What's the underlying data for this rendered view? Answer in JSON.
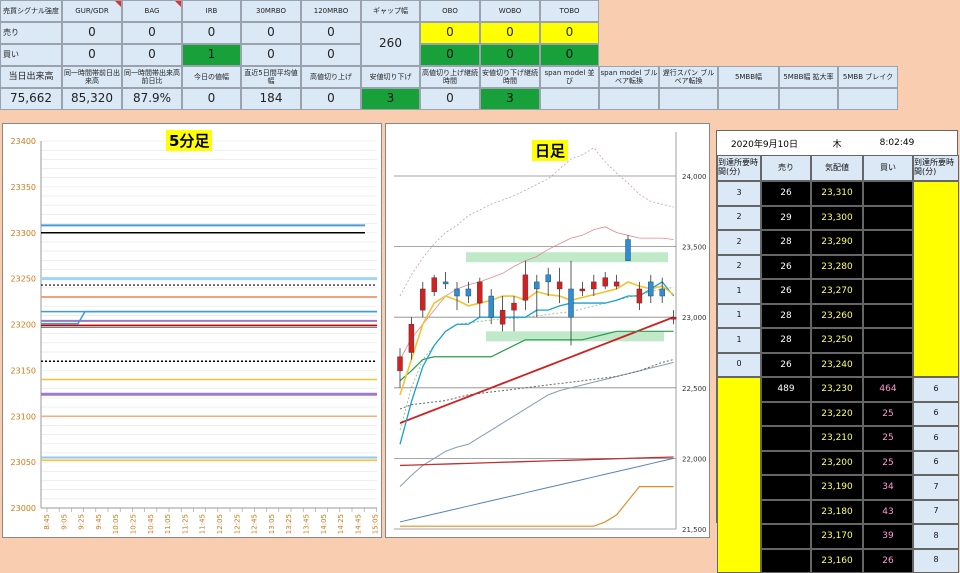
{
  "header": {
    "corner": "売買シグナル強度",
    "cols": [
      "GUR/GDR",
      "BAG",
      "IRB",
      "30MRBO",
      "120MRBO",
      "ギャップ幅",
      "OBO",
      "WOBO",
      "TOBO"
    ],
    "rows": [
      {
        "label": "売り",
        "values": [
          "0",
          "0",
          "0",
          "0",
          "0",
          "0",
          "0",
          "0"
        ]
      },
      {
        "label": "買い",
        "values": [
          "0",
          "0",
          "1",
          "0",
          "0",
          "0",
          "0",
          "0"
        ]
      }
    ],
    "gap_value": "260",
    "stat_labels": [
      "当日出来高",
      "同一時間帯前日出来高",
      "同一時間帯出来高前日比",
      "今日の値幅",
      "直近5日間平均値幅",
      "高値切り上げ",
      "安値切り下げ",
      "高値切り上げ継続時間",
      "安値切り下げ継続時間",
      "span model 並び",
      "span model ブルベア転換",
      "遅行スパン ブルベア転換",
      "5MBB幅",
      "5MBB幅 拡大率",
      "5MBB ブレイク"
    ],
    "stat_values": [
      "75,662",
      "85,320",
      "87.9%",
      "0",
      "184",
      "0",
      "3",
      "0",
      "3",
      "",
      "",
      "",
      "",
      "",
      ""
    ]
  },
  "left_chart": {
    "title": "5分足",
    "y_ticks": [
      "23400",
      "23350",
      "23300",
      "23250",
      "23200",
      "23150",
      "23100",
      "23050",
      "23000"
    ],
    "x_ticks": [
      "8:45",
      "9:05",
      "9:25",
      "9:45",
      "10:05",
      "10:25",
      "10:45",
      "11:05",
      "11:25",
      "11:45",
      "12:05",
      "12:25",
      "12:45",
      "13:05",
      "13:25",
      "13:45",
      "14:05",
      "14:25",
      "14:45",
      "15:05"
    ]
  },
  "right_chart": {
    "title": "日足",
    "y_ticks": [
      "24,000",
      "23,500",
      "23,000",
      "22,500",
      "22,000",
      "21,500"
    ]
  },
  "order_book": {
    "date": "2020年9月10日",
    "weekday": "木",
    "time": "8:02:49",
    "headers": [
      "到達所要時間(分)",
      "売り",
      "気配値",
      "買い",
      "到達所要時間(分)"
    ],
    "asks": [
      {
        "t": "3",
        "qty": "26",
        "price": "23,310"
      },
      {
        "t": "2",
        "qty": "29",
        "price": "23,300"
      },
      {
        "t": "2",
        "qty": "28",
        "price": "23,290"
      },
      {
        "t": "2",
        "qty": "26",
        "price": "23,280"
      },
      {
        "t": "1",
        "qty": "26",
        "price": "23,270"
      },
      {
        "t": "1",
        "qty": "28",
        "price": "23,260"
      },
      {
        "t": "1",
        "qty": "28",
        "price": "23,250"
      },
      {
        "t": "0",
        "qty": "26",
        "price": "23,240"
      }
    ],
    "mid": {
      "sell": "489",
      "price": "23,230",
      "buy": "464",
      "t": "6"
    },
    "bids": [
      {
        "price": "23,220",
        "qty": "25",
        "t": "6"
      },
      {
        "price": "23,210",
        "qty": "25",
        "t": "6"
      },
      {
        "price": "23,200",
        "qty": "25",
        "t": "6"
      },
      {
        "price": "23,190",
        "qty": "34",
        "t": "7"
      },
      {
        "price": "23,180",
        "qty": "43",
        "t": "7"
      },
      {
        "price": "23,170",
        "qty": "39",
        "t": "8"
      },
      {
        "price": "23,160",
        "qty": "26",
        "t": "8"
      }
    ]
  }
}
